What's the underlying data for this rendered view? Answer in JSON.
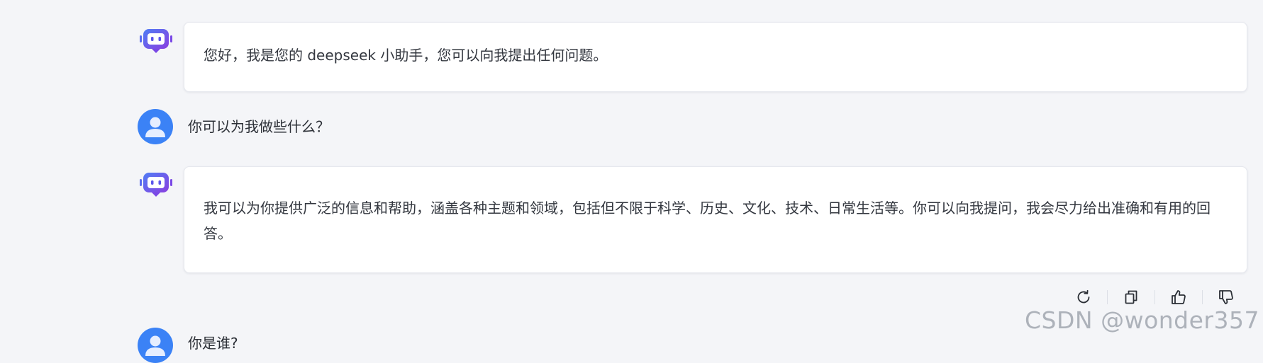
{
  "messages": [
    {
      "role": "assistant",
      "text": "您好，我是您的 deepseek 小助手，您可以向我提出任何问题。"
    },
    {
      "role": "user",
      "text": "你可以为我做些什么？"
    },
    {
      "role": "assistant",
      "text": "我可以为你提供广泛的信息和帮助，涵盖各种主题和领域，包括但不限于科学、历史、文化、技术、日常生活等。你可以向我提问，我会尽力给出准确和有用的回答。"
    },
    {
      "role": "user",
      "text": "你是谁?"
    }
  ],
  "actions": [
    {
      "icon": "refresh-icon"
    },
    {
      "icon": "copy-icon"
    },
    {
      "icon": "thumbs-up-icon"
    },
    {
      "icon": "thumbs-down-icon"
    }
  ],
  "watermark": "CSDN @wonder357",
  "colors": {
    "background": "#f4f5f8",
    "user_avatar": "#3b82f6",
    "bot_avatar": "#6d4ae8"
  }
}
